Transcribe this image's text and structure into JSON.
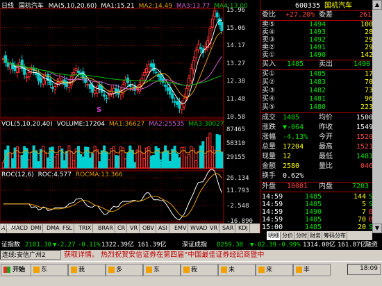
{
  "chart_header": {
    "period": "日线",
    "stock_name": "国机汽车",
    "ma_label": "MA(5,10,20,60)",
    "ma1": "MA1:15.21",
    "ma2": "MA2:14.49",
    "ma3": "MA3:13.77",
    "ma4": "MA4:13.00"
  },
  "price_axis": [
    "15.96",
    "15.06",
    "14.17",
    "13.27",
    "12.38",
    "11.48",
    "10.58"
  ],
  "volume_header": {
    "label": "VOL(5,10,20,40)",
    "volume": "VOLUME:17204",
    "ma1": "MA1:36627",
    "ma2": "MA2:25535",
    "ma3": "MA3:30027"
  },
  "volume_axis": [
    "87465",
    "58310",
    "29155"
  ],
  "roc_header": {
    "label": "ROC(12,6)",
    "roc": "ROC:4.577",
    "rocma": "ROCMA:13.366"
  },
  "roc_axis": [
    "26.134",
    "11.793",
    "-2.548",
    "-16.890"
  ],
  "date_labels": [
    "13/01",
    "03",
    "07",
    "08"
  ],
  "s_marker": "S",
  "indicator_tabs": [
    "A",
    "MACD",
    "DMI",
    "DMA",
    "FSL",
    "TRIX",
    "BRAR",
    "CR",
    "VR",
    "OBV",
    "ASI",
    "EMV",
    "WVAD",
    "VR",
    "SAR",
    "KDJ"
  ],
  "quote": {
    "code": "600335",
    "name": "国机汽车",
    "weibi_label": "委比",
    "weibi_value": "+27.20%",
    "weicha_label": "委差",
    "weicha_value": "261",
    "sell": [
      {
        "label": "卖⑤",
        "price": "1494",
        "vol": "100"
      },
      {
        "label": "卖④",
        "price": "1493",
        "vol": "28"
      },
      {
        "label": "卖③",
        "price": "1492",
        "vol": "29"
      },
      {
        "label": "卖②",
        "price": "1491",
        "vol": "29"
      },
      {
        "label": "卖①",
        "price": "1490",
        "vol": "142"
      }
    ],
    "trade_line": {
      "l1": "买入",
      "v1": "1485",
      "l2": "卖出",
      "v2": "1490"
    },
    "buy": [
      {
        "label": "买①",
        "price": "1485",
        "vol": "17"
      },
      {
        "label": "买②",
        "price": "1483",
        "vol": "70"
      },
      {
        "label": "买③",
        "price": "1482",
        "vol": "73"
      },
      {
        "label": "买④",
        "price": "1481",
        "vol": "96"
      },
      {
        "label": "买⑤",
        "price": "1480",
        "vol": "223"
      }
    ],
    "stats": [
      {
        "l1": "成交",
        "v1": "1485",
        "l2": "均价",
        "v2": "1500"
      },
      {
        "l1": "涨跌",
        "v1": "▼-064",
        "l2": "昨收",
        "v2": "1549"
      },
      {
        "l1": "涨幅",
        "v1": "-4.13%",
        "l2": "今开",
        "v2": "1520"
      },
      {
        "l1": "总量",
        "v1": "17204",
        "l2": "最高",
        "v2": "1521"
      },
      {
        "l1": "现量",
        "v1": "12",
        "l2": "最低",
        "v2": "1481"
      },
      {
        "l1": "金额",
        "v1": "2580",
        "l2": "量比",
        "v2": "046"
      },
      {
        "l1": "换手",
        "v1": "0.62%",
        "l2": "",
        "v2": ""
      }
    ],
    "outer_inner": {
      "l1": "外盘",
      "v1": "10001",
      "l2": "内盘",
      "v2": "7203"
    },
    "ticks": [
      {
        "time": "14:59",
        "price": "1485",
        "vol": "144",
        "flag": "S"
      },
      {
        "time": "14:59",
        "price": "1485",
        "vol": "5",
        "flag": "S"
      },
      {
        "time": "14:59",
        "price": "1490",
        "vol": "7",
        "flag": "B"
      },
      {
        "time": "14:59",
        "price": "1485",
        "vol": "70",
        "flag": "B"
      },
      {
        "time": "15:00",
        "price": "1485",
        "vol": "20",
        "flag": "S"
      }
    ],
    "tabs": [
      "明细",
      "分价",
      "分时",
      "财务",
      "筹码分布"
    ]
  },
  "status_bar": {
    "index1_name": "证指数",
    "index1_value": "2101.30",
    "index1_change": "▼-2.27",
    "index1_pct": "-0.11%",
    "index1_amount": "1322.39亿",
    "index1_amount2": "161.39亿",
    "index1_extra": "深证成指",
    "index2_value": "8259.38",
    "index2_change": "▼-82.39",
    "index2_pct": "-0.99%",
    "index2_amount": "1314.00亿",
    "index2_amount2": "161.87亿",
    "index2_extra": "融资"
  },
  "ticker": {
    "left": "连线:安信广州2",
    "scroll": "获取详情。   热烈祝贺安信证券在第四届“中国最佳证券经纪商暨中"
  },
  "taskbar": {
    "start": "开始",
    "time": "18:09",
    "buttons": [
      "东",
      "我",
      "多",
      "东",
      "我",
      "未",
      "来",
      "丰"
    ]
  }
}
